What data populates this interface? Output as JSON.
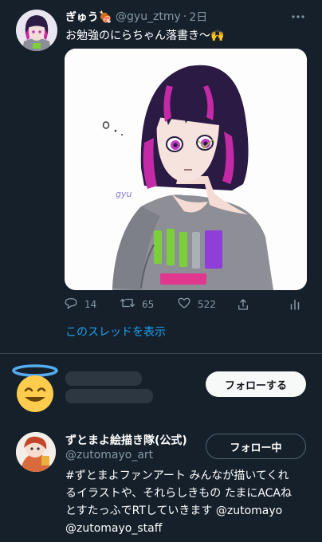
{
  "tweet": {
    "author_name": "ぎゅう🍖",
    "handle": "@gyu_ztmy",
    "separator": "·",
    "time": "2日",
    "text": "お勉強のにらちゃん落書き〜🙌",
    "icons": {
      "more": "more-icon",
      "reply": "reply-icon",
      "retweet": "retweet-icon",
      "like": "like-icon",
      "share": "share-icon",
      "analytics": "analytics-icon"
    },
    "image_signature": "gyu",
    "replies": "14",
    "retweets": "65",
    "likes": "522",
    "show_thread": "このスレッドを表示"
  },
  "suggestions": [
    {
      "avatar_icon": "halo-smiling-face-icon",
      "button": "フォローする"
    },
    {
      "name": "ずとまよ絵描き隊(公式)",
      "handle": "@zutomayo_art",
      "button": "フォロー中",
      "bio_lines": [
        "#ずとまよファンアート みんなが描いてくれ",
        "るイラストや、それらしきもの たまにACAね",
        "とすたっふでRTしていきます @zutomayo",
        "@zutomayo_staff"
      ]
    }
  ],
  "colors": {
    "background": "#15202b",
    "link": "#1da1f2",
    "muted": "#8899a6",
    "divider": "#38444d"
  }
}
